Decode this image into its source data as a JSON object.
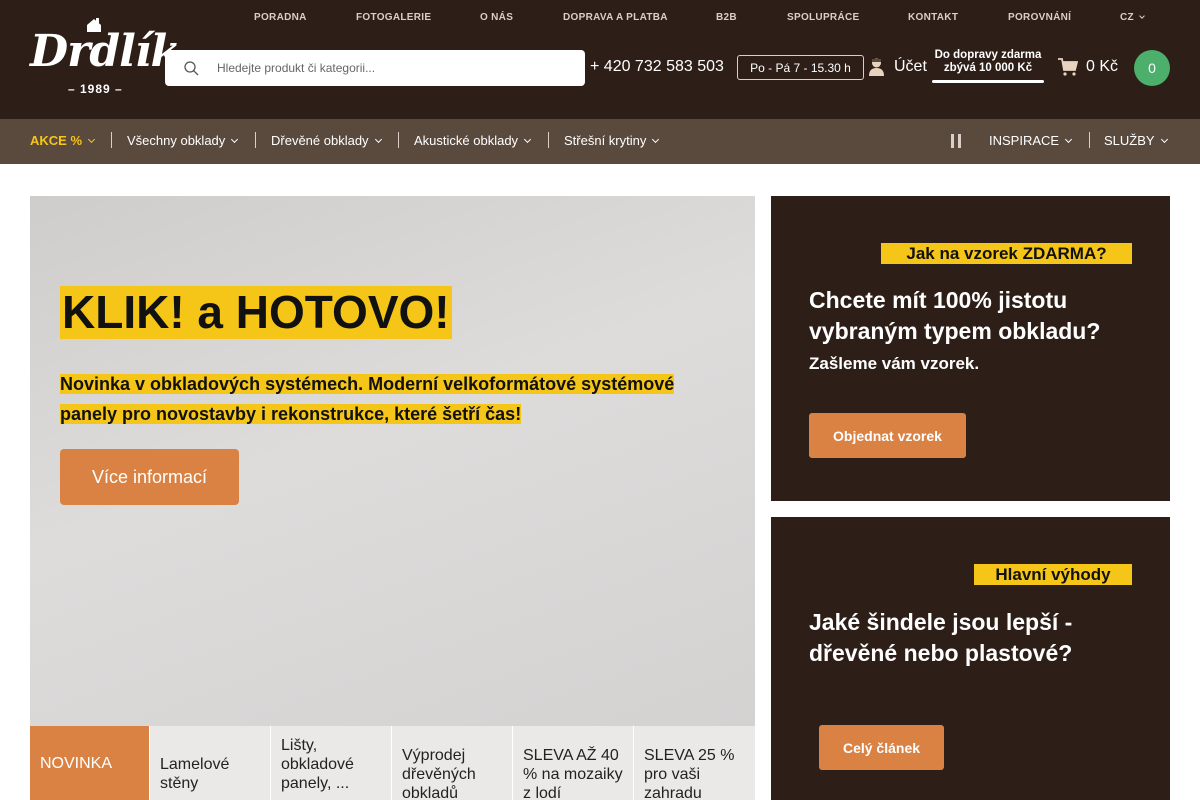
{
  "topnav": {
    "items": [
      "PORADNA",
      "FOTOGALERIE",
      "O NÁS",
      "DOPRAVA A PLATBA",
      "B2B",
      "SPOLUPRÁCE",
      "KONTAKT",
      "POROVNÁNÍ"
    ],
    "language": "CZ"
  },
  "logo": {
    "word": "Drdlík",
    "year": "– 1989 –"
  },
  "search": {
    "placeholder": "Hledejte produkt či kategorii..."
  },
  "contact": {
    "phone": "+ 420 732 583 503",
    "hours": "Po - Pá 7 - 15.30 h"
  },
  "account": {
    "label": "Účet"
  },
  "shipping": {
    "line1": "Do dopravy zdarma",
    "line2": "zbývá 10 000 Kč",
    "progress": 0
  },
  "cart": {
    "total": "0 Kč",
    "count": "0"
  },
  "mainnav": {
    "items": [
      {
        "label": "AKCE %"
      },
      {
        "label": "Všechny obklady"
      },
      {
        "label": "Dřevěné obklady"
      },
      {
        "label": "Akustické obklady"
      },
      {
        "label": "Střešní krytiny"
      }
    ],
    "right": [
      {
        "label": "INSPIRACE"
      },
      {
        "label": "SLUŽBY"
      }
    ]
  },
  "hero": {
    "title": "KLIK! a HOTOVO!",
    "subtitle": "Novinka v obkladových systémech. Moderní velkoformátové systémové panely pro novostavby i rekonstrukce, které šetří čas!",
    "button": "Více informací"
  },
  "categories": [
    "NOVINKA",
    "Lamelové stěny",
    "Lišty, obkladové panely, ...",
    "Výprodej dřevěných obkladů",
    "SLEVA AŽ 40 % na mozaiky z lodí",
    "SLEVA 25 % pro vaši zahradu"
  ],
  "card1": {
    "tag": "Jak na vzorek ZDARMA?",
    "heading": "Chcete mít 100% jistotu vybraným typem obkladu?",
    "subheading": "Zašleme vám vzorek.",
    "button": "Objednat vzorek"
  },
  "card2": {
    "tag": "Hlavní výhody",
    "heading": "Jaké šindele jsou lepší - dřevěné nebo plastové?",
    "button": "Celý článek"
  },
  "colors": {
    "brown_dark": "#2d1e17",
    "nav_brown": "#5a4a3e",
    "accent_yellow": "#f5c518",
    "accent_orange": "#d98243",
    "cart_green": "#4caf6b"
  }
}
